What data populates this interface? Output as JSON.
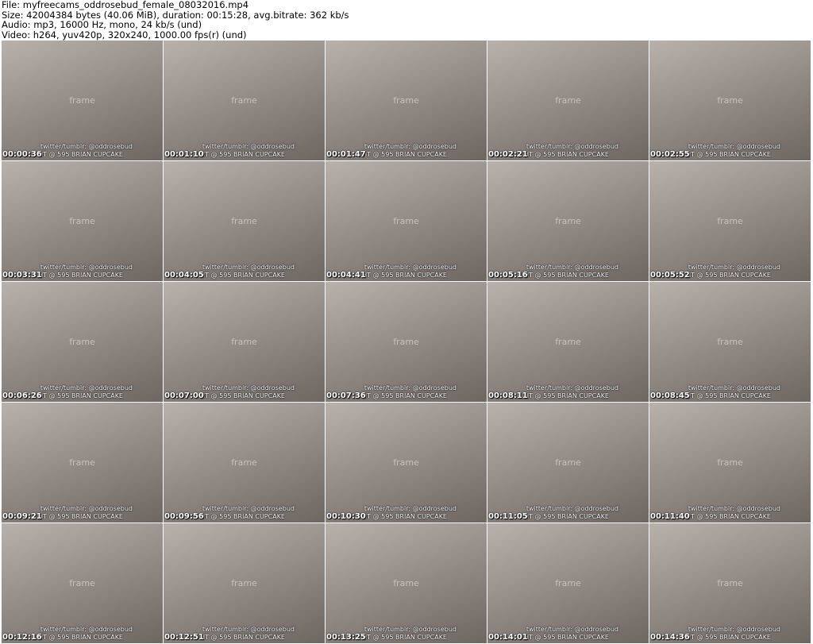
{
  "header": {
    "file": "File: myfreecams_oddrosebud_female_08032016.mp4",
    "size": "Size: 42004384 bytes (40.06 MiB), duration: 00:15:28, avg.bitrate: 362 kb/s",
    "audio": "Audio: mp3, 16000 Hz, mono, 24 kb/s (und)",
    "video": "Video: h264, yuv420p, 320x240, 1000.00 fps(r) (und)"
  },
  "overlay": {
    "line1": "twitter/tumblr: @oddrosebud",
    "line2": "HT @ 595 BRIAN CUPCAKE",
    "placeholder": "frame"
  },
  "thumbnails": [
    "00:00:36",
    "00:01:10",
    "00:01:47",
    "00:02:21",
    "00:02:55",
    "00:03:31",
    "00:04:05",
    "00:04:41",
    "00:05:16",
    "00:05:52",
    "00:06:26",
    "00:07:00",
    "00:07:36",
    "00:08:11",
    "00:08:45",
    "00:09:21",
    "00:09:56",
    "00:10:30",
    "00:11:05",
    "00:11:40",
    "00:12:16",
    "00:12:51",
    "00:13:25",
    "00:14:01",
    "00:14:36"
  ]
}
